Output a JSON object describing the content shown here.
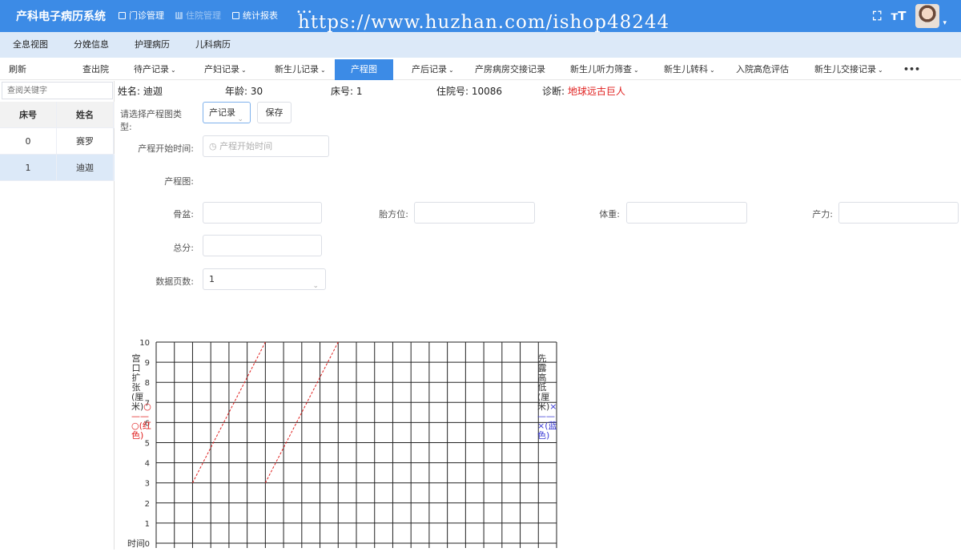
{
  "header": {
    "title": "产科电子病历系统",
    "nav": [
      {
        "label": "门诊管理",
        "icon": "grid-icon"
      },
      {
        "label": "住院管理",
        "icon": "bar-chart-icon"
      },
      {
        "label": "统计报表",
        "icon": "table-icon"
      }
    ],
    "more": "•••",
    "watermark": "https://www.huzhan.com/ishop48244",
    "fullscreen_icon": "⛶",
    "font_size_icon": "ᴛT"
  },
  "subnav": [
    "全息视图",
    "分娩信息",
    "护理病历",
    "儿科病历"
  ],
  "tabs": {
    "refresh": "刷新",
    "discharge": "查出院",
    "items": [
      "待产记录",
      "产妇记录",
      "新生儿记录",
      "产程图",
      "产后记录",
      "产房病房交接记录",
      "新生儿听力筛查",
      "新生儿转科",
      "入院高危评估",
      "新生儿交接记录"
    ],
    "active": "产程图",
    "more": "•••"
  },
  "sidebar": {
    "search_placeholder": "查阅关键字",
    "headers": [
      "床号",
      "姓名"
    ],
    "rows": [
      {
        "bed": "0",
        "name": "赛罗"
      },
      {
        "bed": "1",
        "name": "迪迦"
      }
    ],
    "selected_bed": "1"
  },
  "patient": {
    "name_label": "姓名:",
    "name": "迪迦",
    "age_label": "年龄:",
    "age": "30",
    "bed_label": "床号:",
    "bed": "1",
    "admission_label": "住院号:",
    "admission": "10086",
    "diagnosis_label": "诊断:",
    "diagnosis": "地球远古巨人",
    "diagnosis_color": "#e0201f"
  },
  "form": {
    "type_label": "请选择产程图类型:",
    "type_value": "产记录",
    "save": "保存",
    "start_label": "产程开始时间:",
    "start_placeholder": "产程开始时间",
    "chart_label": "产程图:",
    "pelvis_label": "骨盆:",
    "fetal_position_label": "胎方位:",
    "weight_label": "体重:",
    "force_label": "产力:",
    "total_label": "总分:",
    "pages_label": "数据页数:",
    "pages_value": "1"
  },
  "chart_data": {
    "type": "line",
    "y_left_label": "宫口扩张(厘米)○——○(红色)",
    "y_right_label": "先露高低(厘米)×——×(蓝色)",
    "x_label": "时间",
    "ylim": [
      0,
      10
    ],
    "yticks": [
      0,
      1,
      2,
      3,
      4,
      5,
      6,
      7,
      8,
      9,
      10
    ],
    "x_columns": 22,
    "grid": true,
    "series": [
      {
        "values": [
          [
            2,
            3
          ],
          [
            6,
            10
          ]
        ],
        "color": "#e0201f",
        "style": "dashed"
      },
      {
        "values": [
          [
            6,
            3
          ],
          [
            10,
            10
          ]
        ],
        "color": "#e0201f",
        "style": "dashed"
      }
    ]
  }
}
